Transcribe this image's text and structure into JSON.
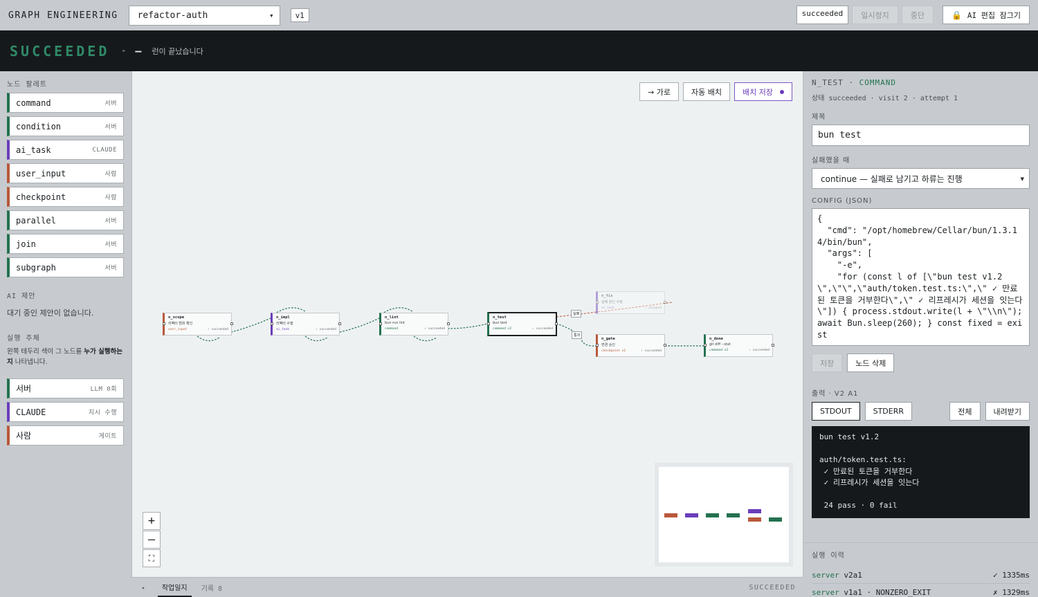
{
  "topbar": {
    "brand": "GRAPH ENGINEERING",
    "graph_select": "refactor-auth",
    "version": "v1",
    "run_state": "succeeded",
    "pause_label": "일시정지",
    "stop_label": "중단",
    "ai_lock_label": "AI 편집 잠그기"
  },
  "status_band": {
    "title": "SUCCEEDED",
    "dash": "—",
    "message": "런이 끝났습니다"
  },
  "palette": {
    "title": "노드 팔레트",
    "items": [
      {
        "label": "command",
        "tag": "서버",
        "color": "#23714f"
      },
      {
        "label": "condition",
        "tag": "서버",
        "color": "#23714f"
      },
      {
        "label": "ai_task",
        "tag": "CLAUDE",
        "color": "#6a3dbb"
      },
      {
        "label": "user_input",
        "tag": "사람",
        "color": "#b9583a"
      },
      {
        "label": "checkpoint",
        "tag": "사람",
        "color": "#b9583a"
      },
      {
        "label": "parallel",
        "tag": "서버",
        "color": "#23714f"
      },
      {
        "label": "join",
        "tag": "서버",
        "color": "#23714f"
      },
      {
        "label": "subgraph",
        "tag": "서버",
        "color": "#23714f"
      }
    ]
  },
  "ai_suggest": {
    "title": "AI 제안",
    "empty": "대기 중인 제안이 없습니다."
  },
  "actors": {
    "title": "실행 주체",
    "help_pre": "왼쪽 테두리 색이 그 노드를 ",
    "help_bold": "누가 실행하는지",
    "help_post": " 나타냅니다.",
    "items": [
      {
        "label": "서버",
        "tag": "LLM 0회",
        "color": "#23714f"
      },
      {
        "label": "CLAUDE",
        "tag": "지시 수행",
        "color": "#6a3dbb"
      },
      {
        "label": "사람",
        "tag": "게이트",
        "color": "#b9583a"
      }
    ]
  },
  "canvas": {
    "layout_label": "→ 가로",
    "autolayout_label": "자동 배치",
    "save_layout_label": "배치 저장",
    "nodes": {
      "n_scope": {
        "id": "n_scope",
        "title": "리팩터 범위 확인",
        "kind": "user_input",
        "status": "✓ succeeded",
        "color": "#b9583a"
      },
      "n_impl": {
        "id": "n_impl",
        "title": "리팩터 수행",
        "kind": "ai_task",
        "status": "✓ succeeded",
        "color": "#6a3dbb"
      },
      "n_lint": {
        "id": "n_lint",
        "title": "bun run lint",
        "kind": "command",
        "status": "✓ succeeded",
        "color": "#23714f"
      },
      "n_test": {
        "id": "n_test",
        "title": "bun test",
        "kind": "command v2",
        "status": "✓ succeeded",
        "color": "#23714f"
      },
      "n_fix": {
        "id": "n_fix",
        "title": "실패 원인 수정",
        "kind": "ai_task",
        "status": "— skipped",
        "color": "#6a3dbb"
      },
      "n_gate": {
        "id": "n_gate",
        "title": "변경 승인",
        "kind": "checkpoint v2",
        "status": "✓ succeeded",
        "color": "#b9583a"
      },
      "n_done": {
        "id": "n_done",
        "title": "git diff --stat",
        "kind": "command v2",
        "status": "✓ succeeded",
        "color": "#23714f"
      }
    },
    "edge_labels": {
      "fail": "실패",
      "pass": "통과"
    },
    "zoom_in": "+",
    "zoom_out": "—",
    "fit": "⛶"
  },
  "bottombar": {
    "tab": "작업일지",
    "count": "기록 8",
    "state": "SUCCEEDED"
  },
  "inspector": {
    "node_id": "N_TEST",
    "node_type": "COMMAND",
    "sub": "상태 succeeded · visit 2 · attempt 1",
    "title_label": "제목",
    "title_value": "bun test",
    "on_fail_label": "실패했을 때",
    "on_fail_value": "continue — 실패로 남기고 하류는 진행",
    "config_label": "CONFIG (JSON)",
    "config_value": "{\n  \"cmd\": \"/opt/homebrew/Cellar/bun/1.3.14/bin/bun\",\n  \"args\": [\n    \"-e\",\n    \"for (const l of [\\\"bun test v1.2\\\",\\\"\\\",\\\"auth/token.test.ts:\\\",\\\" ✓ 만료된 토큰을 거부한다\\\",\\\" ✓ 리프레시가 세션을 잇는다\\\"]) { process.stdout.write(l + \\\"\\\\n\\\"); await Bun.sleep(260); } const fixed = exist",
    "save_label": "저장",
    "delete_label": "노드 삭제"
  },
  "output": {
    "title": "출력 · V2 A1",
    "stdout_tab": "STDOUT",
    "stderr_tab": "STDERR",
    "all_label": "전체",
    "download_label": "내려받기",
    "text": "bun test v1.2\n\nauth/token.test.ts:\n ✓ 만료된 토큰을 거부한다\n ✓ 리프레시가 세션을 잇는다\n\n 24 pass · 0 fail"
  },
  "history": {
    "title": "실행 이력",
    "rows": [
      {
        "actor": "server",
        "detail": "v2a1",
        "result": "✓ 1335ms"
      },
      {
        "actor": "server",
        "detail": "v1a1 · NONZERO_EXIT",
        "result": "✗ 1329ms"
      }
    ]
  }
}
